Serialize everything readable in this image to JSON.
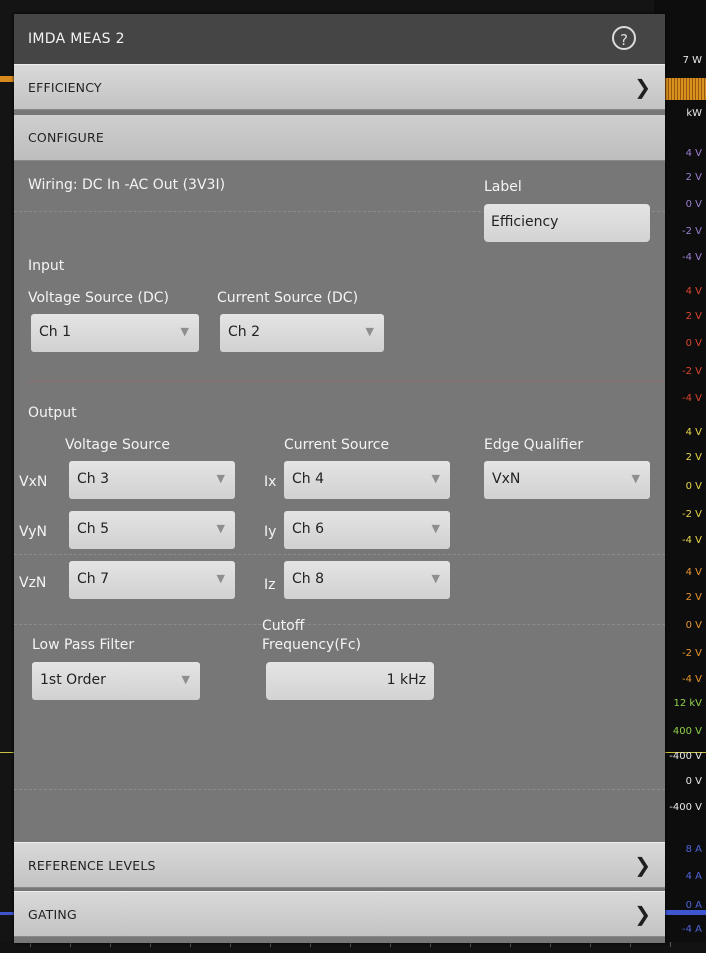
{
  "dialog": {
    "title": "IMDA MEAS 2",
    "help_icon": "?",
    "sections": {
      "efficiency": "EFFICIENCY",
      "configure": "CONFIGURE",
      "reference_levels": "REFERENCE LEVELS",
      "gating": "GATING"
    }
  },
  "configure": {
    "wiring": "Wiring: DC In -AC Out (3V3I)",
    "label_caption": "Label",
    "label_value": "Efficiency",
    "input": {
      "heading": "Input",
      "voltage_source_label": "Voltage Source (DC)",
      "voltage_source_value": "Ch 1",
      "current_source_label": "Current Source (DC)",
      "current_source_value": "Ch 2"
    },
    "output": {
      "heading": "Output",
      "voltage_source_label": "Voltage Source",
      "current_source_label": "Current Source",
      "edge_qualifier_label": "Edge Qualifier",
      "edge_qualifier_value": "VxN",
      "rows": [
        {
          "v_prefix": "VxN",
          "v_value": "Ch 3",
          "i_prefix": "Ix",
          "i_value": "Ch 4"
        },
        {
          "v_prefix": "VyN",
          "v_value": "Ch 5",
          "i_prefix": "Iy",
          "i_value": "Ch 6"
        },
        {
          "v_prefix": "VzN",
          "v_value": "Ch 7",
          "i_prefix": "Iz",
          "i_value": "Ch 8"
        }
      ]
    },
    "low_pass_filter_label": "Low Pass Filter",
    "low_pass_filter_value": "1st Order",
    "cutoff_label_line1": "Cutoff",
    "cutoff_label_line2": "Frequency(Fc)",
    "cutoff_value": "1 kHz"
  },
  "scope_scale": [
    {
      "text": "7 W",
      "color": "#e8e8e8"
    },
    {
      "text": "kW",
      "color": "#e8e8e8"
    },
    {
      "text": "4 V",
      "color": "#9a7fd0"
    },
    {
      "text": "2 V",
      "color": "#9a7fd0"
    },
    {
      "text": "0 V",
      "color": "#9a7fd0"
    },
    {
      "text": "-2 V",
      "color": "#9a7fd0"
    },
    {
      "text": "-4 V",
      "color": "#9a7fd0"
    },
    {
      "text": "4 V",
      "color": "#d9452f"
    },
    {
      "text": "2 V",
      "color": "#d9452f"
    },
    {
      "text": "0 V",
      "color": "#d9452f"
    },
    {
      "text": "-2 V",
      "color": "#d9452f"
    },
    {
      "text": "-4 V",
      "color": "#d9452f"
    },
    {
      "text": "4 V",
      "color": "#e8d84a"
    },
    {
      "text": "2 V",
      "color": "#e8d84a"
    },
    {
      "text": "0 V",
      "color": "#e8d84a"
    },
    {
      "text": "-2 V",
      "color": "#e8d84a"
    },
    {
      "text": "-4 V",
      "color": "#e8d84a"
    },
    {
      "text": "4 V",
      "color": "#e8962e"
    },
    {
      "text": "2 V",
      "color": "#e8962e"
    },
    {
      "text": "0 V",
      "color": "#e8962e"
    },
    {
      "text": "-2 V",
      "color": "#e8962e"
    },
    {
      "text": "-4 V",
      "color": "#e8962e"
    },
    {
      "text": "12 kV",
      "color": "#8fd14a"
    },
    {
      "text": "400 V",
      "color": "#8fd14a"
    },
    {
      "text": "-400 V",
      "color": "#e8e8e8"
    },
    {
      "text": "0 V",
      "color": "#e8e8e8"
    },
    {
      "text": "-400 V",
      "color": "#e8e8e8"
    },
    {
      "text": "8 A",
      "color": "#4f63d9"
    },
    {
      "text": "4 A",
      "color": "#4f63d9"
    },
    {
      "text": "0 A",
      "color": "#4f63d9"
    },
    {
      "text": "-4 A",
      "color": "#4f63d9"
    }
  ],
  "colors": {
    "dialog_bg": "#777777",
    "title_bg": "#454545",
    "section_bar": "#cfcfcf",
    "field_bg": "#dadada"
  }
}
